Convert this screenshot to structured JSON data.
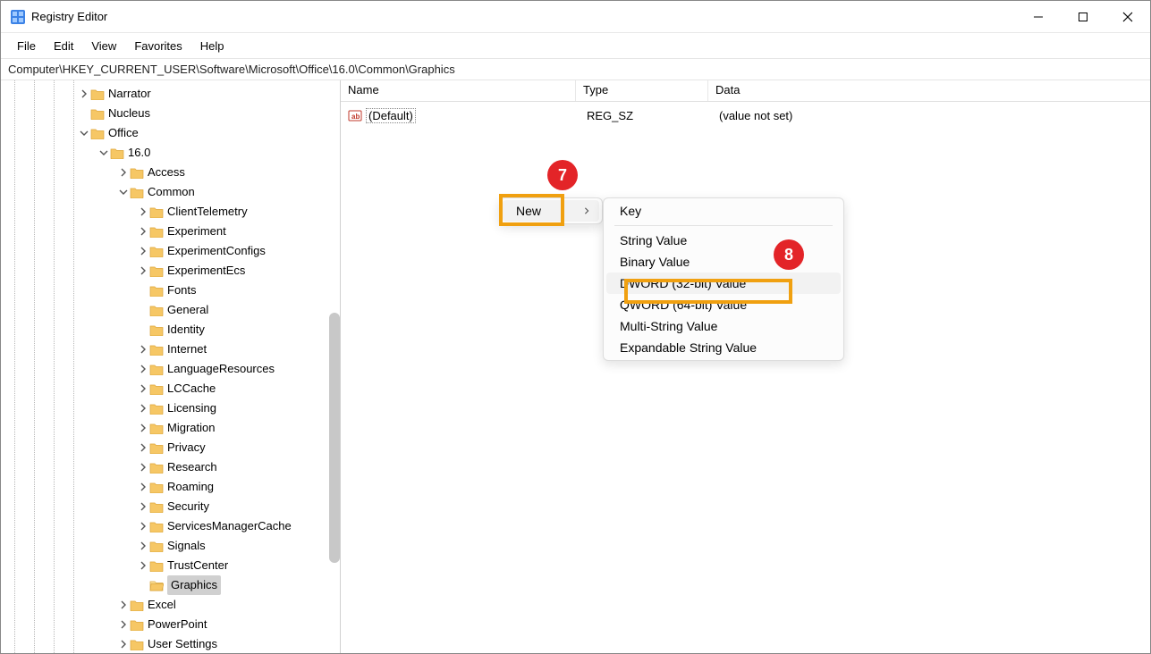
{
  "title": "Registry Editor",
  "menus": {
    "file": "File",
    "edit": "Edit",
    "view": "View",
    "favorites": "Favorites",
    "help": "Help"
  },
  "address": "Computer\\HKEY_CURRENT_USER\\Software\\Microsoft\\Office\\16.0\\Common\\Graphics",
  "tree": {
    "narrator": "Narrator",
    "nucleus": "Nucleus",
    "office": "Office",
    "v16": "16.0",
    "access": "Access",
    "common": "Common",
    "clienttelemetry": "ClientTelemetry",
    "experiment": "Experiment",
    "experimentconfigs": "ExperimentConfigs",
    "experimentecs": "ExperimentEcs",
    "fonts": "Fonts",
    "general": "General",
    "identity": "Identity",
    "internet": "Internet",
    "languageresources": "LanguageResources",
    "lccache": "LCCache",
    "licensing": "Licensing",
    "migration": "Migration",
    "privacy": "Privacy",
    "research": "Research",
    "roaming": "Roaming",
    "security": "Security",
    "servicesmanagercache": "ServicesManagerCache",
    "signals": "Signals",
    "trustcenter": "TrustCenter",
    "graphics": "Graphics",
    "excel": "Excel",
    "powerpoint": "PowerPoint",
    "usersettings": "User Settings"
  },
  "columns": {
    "name": "Name",
    "type": "Type",
    "data": "Data"
  },
  "value_row": {
    "name": "(Default)",
    "type": "REG_SZ",
    "data": "(value not set)"
  },
  "context_menu": {
    "new": "New",
    "submenu": {
      "key": "Key",
      "string": "String Value",
      "binary": "Binary Value",
      "dword": "DWORD (32-bit) Value",
      "qword": "QWORD (64-bit) Value",
      "multistring": "Multi-String Value",
      "expandable": "Expandable String Value"
    }
  },
  "callouts": {
    "step7": "7",
    "step8": "8"
  }
}
